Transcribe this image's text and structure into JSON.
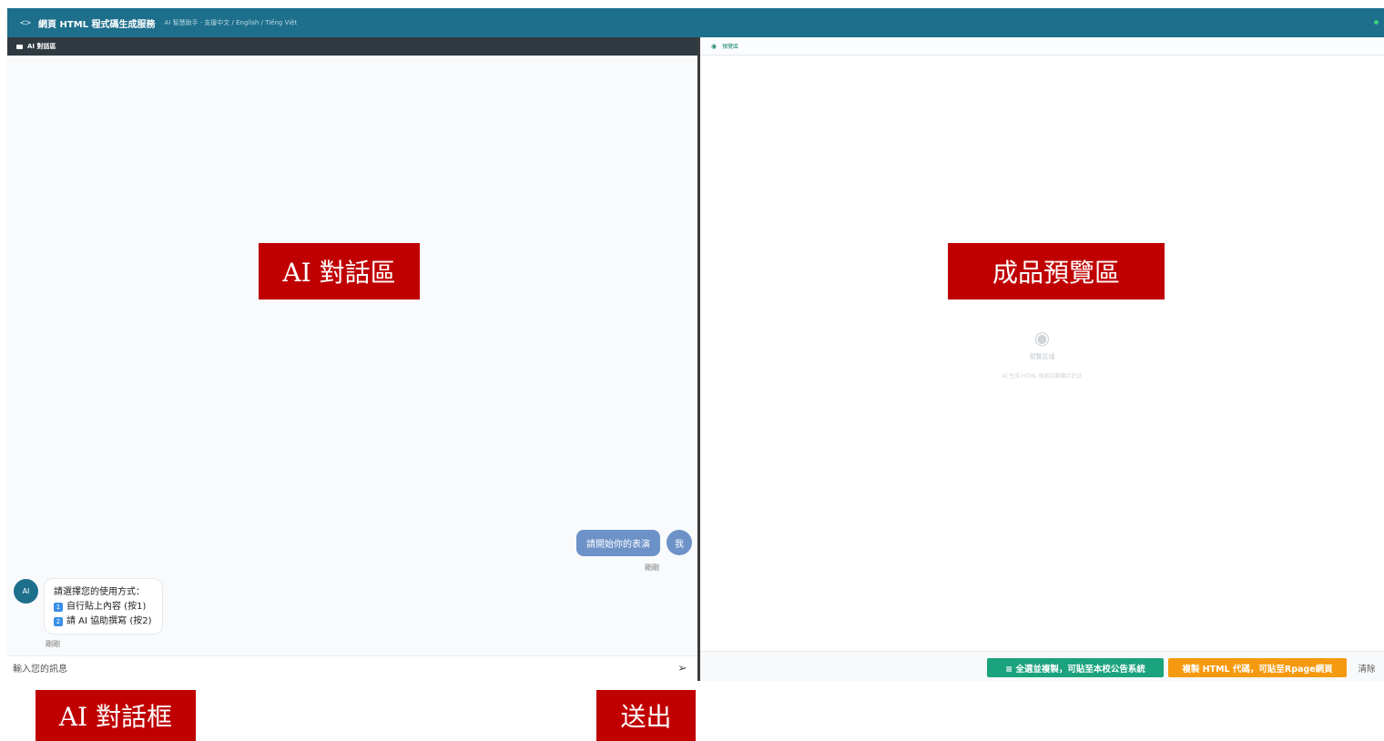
{
  "header": {
    "code_icon": "<>",
    "title": "網頁 HTML 程式碼生成服務",
    "subtitle": "AI 智慧助手 · 支援中文 / English / Tiếng Việt"
  },
  "chat_panel": {
    "heading": "AI 對話區",
    "messages": [
      {
        "role": "user",
        "avatar": "我",
        "text": "請開始你的表演",
        "time": "剛剛"
      },
      {
        "role": "ai",
        "avatar": "AI",
        "lines": [
          "請選擇您的使用方式：",
          "自行貼上內容 (按1)",
          "請 AI 協助撰寫 (按2)"
        ],
        "badges": [
          "1",
          "2"
        ],
        "time": "剛剛"
      }
    ],
    "input_placeholder": "輸入您的訊息",
    "send_icon": "send-icon"
  },
  "preview_panel": {
    "heading": "預覽區",
    "empty_title": "預覽區域",
    "empty_desc": "AI 生成 HTML 後將自動顯示於此",
    "buttons": {
      "copy_all": "≡ 全選並複製，可貼至本校公告系統",
      "copy_html": "複製 HTML 代碼，可貼至Rpage網頁",
      "clear": "清除"
    }
  },
  "annotations": {
    "chat_area": "AI 對話區",
    "preview_area": "成品預覽區",
    "chat_box": "AI 對話框",
    "send": "送出"
  },
  "colors": {
    "header_bg": "#1d6f8c",
    "annotation_bg": "#c00000",
    "green_button": "#1ba37e",
    "orange_button": "#f59a10",
    "user_bubble": "#6d92c8"
  }
}
